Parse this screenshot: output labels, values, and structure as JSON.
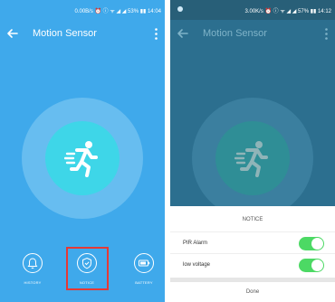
{
  "colors": {
    "left_background": "#3fa9eb",
    "right_background": "#2c6f8f",
    "accent_cyan": "#3ed6e8",
    "toggle_on": "#4cd964",
    "highlight": "#e53935"
  },
  "left": {
    "status": {
      "text": "0.00B/s ⏰ ⓘ ᯤ ◢ ◢ 53% ▮▮ 14:04"
    },
    "appbar": {
      "title": "Motion Sensor",
      "back_icon": "arrow-left",
      "more_icon": "vertical-dots"
    },
    "center_icon": "running-person",
    "nav": [
      {
        "label": "HISTORY",
        "icon": "bell"
      },
      {
        "label": "NOTICE",
        "icon": "shield"
      },
      {
        "label": "BATTERY",
        "icon": "battery"
      }
    ]
  },
  "right": {
    "status": {
      "text": "3.00K/s ⏰ ⓘ ᯤ ◢ ◢ 57% ▮▮ 14:12"
    },
    "appbar": {
      "title": "Motion Sensor"
    },
    "sheet": {
      "title": "NOTICE",
      "rows": [
        {
          "label": "PIR Alarm",
          "enabled": true
        },
        {
          "label": "low voltage",
          "enabled": true
        }
      ],
      "done_label": "Done"
    }
  }
}
